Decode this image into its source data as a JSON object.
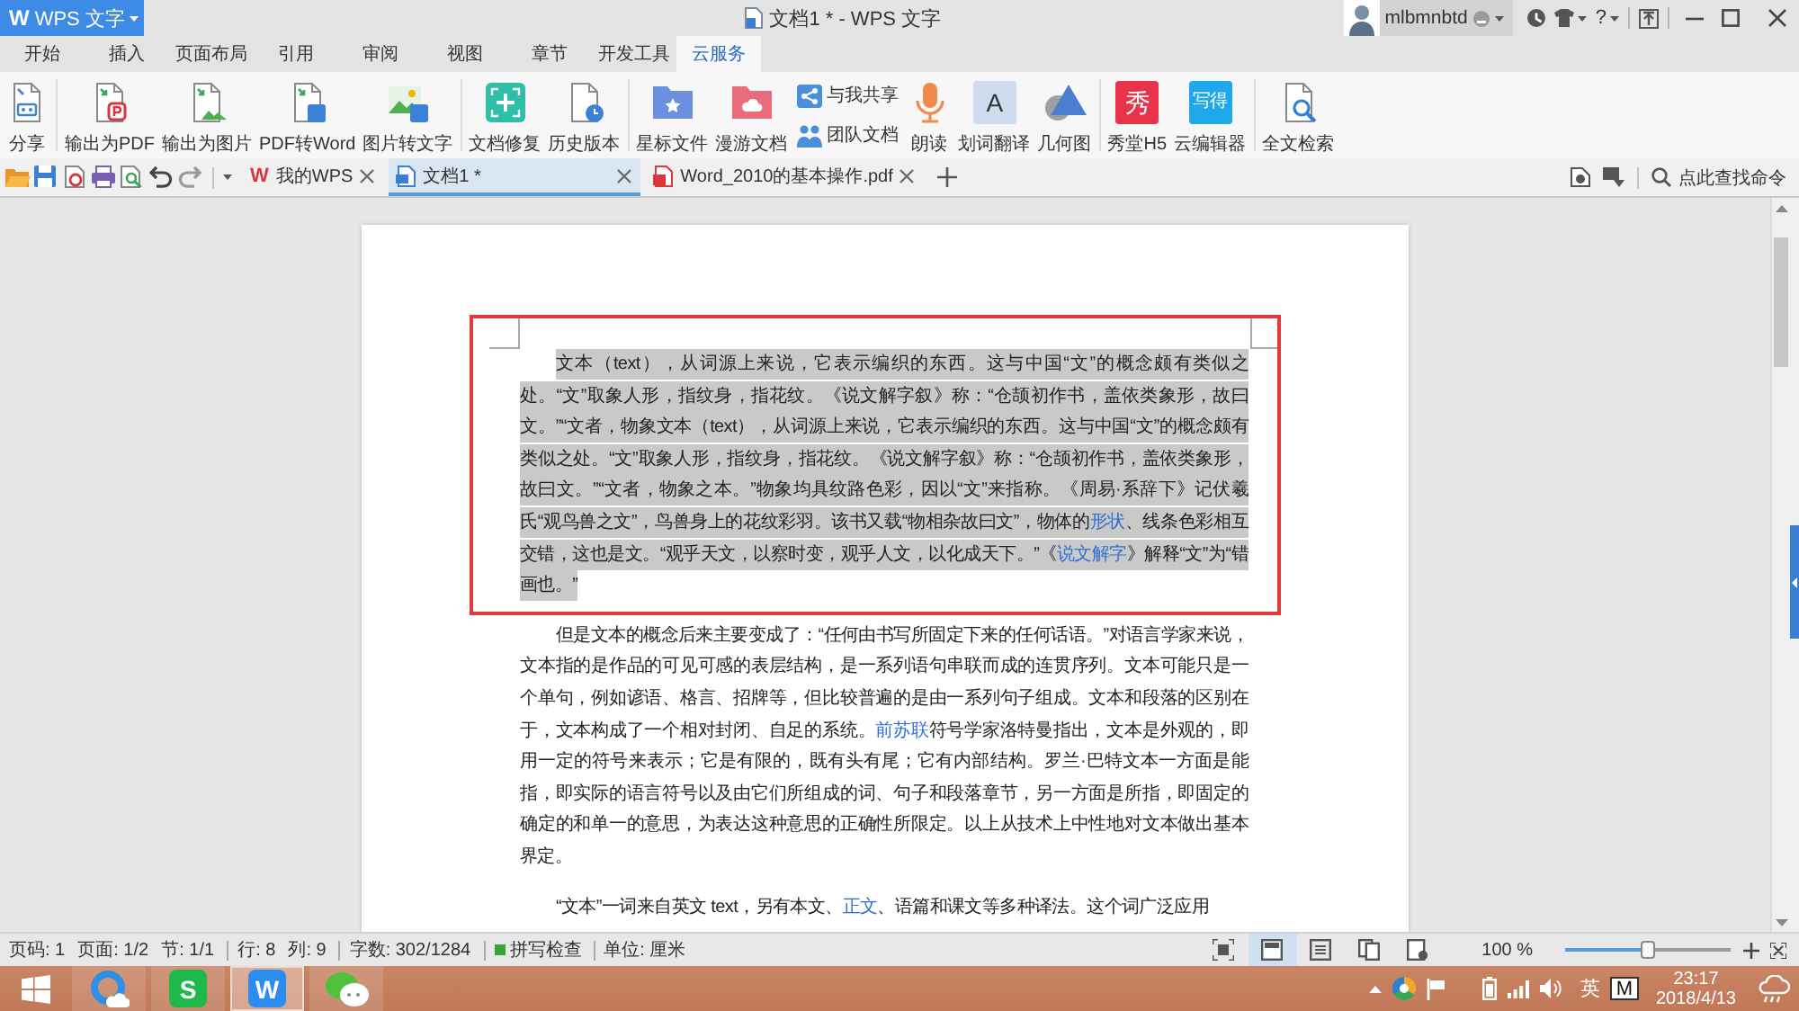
{
  "title_bar": {
    "app_menu": {
      "logo": "W",
      "label": "WPS 文字"
    },
    "title": "文档1 * - WPS 文字",
    "user": "mlbmnbtd",
    "help": "?"
  },
  "menu_tabs": [
    {
      "label": "开始",
      "selected": false
    },
    {
      "label": "插入",
      "selected": false
    },
    {
      "label": "页面布局",
      "selected": false
    },
    {
      "label": "引用",
      "selected": false
    },
    {
      "label": "审阅",
      "selected": false
    },
    {
      "label": "视图",
      "selected": false
    },
    {
      "label": "章节",
      "selected": false
    },
    {
      "label": "开发工具",
      "selected": false
    },
    {
      "label": "云服务",
      "selected": true
    }
  ],
  "ribbon": {
    "groups": [
      [
        {
          "kind": "large",
          "label": "分享"
        }
      ],
      [
        {
          "kind": "large",
          "label": "输出为PDF"
        },
        {
          "kind": "large",
          "label": "输出为图片"
        },
        {
          "kind": "large",
          "label": "PDF转Word"
        },
        {
          "kind": "large",
          "label": "图片转文字"
        }
      ],
      [
        {
          "kind": "large",
          "label": "文档修复"
        },
        {
          "kind": "large",
          "label": "历史版本"
        }
      ],
      [
        {
          "kind": "large",
          "label": "星标文件"
        },
        {
          "kind": "large",
          "label": "漫游文档"
        },
        {
          "kind": "stack",
          "items": [
            {
              "label": "与我共享"
            },
            {
              "label": "团队文档"
            }
          ]
        },
        {
          "kind": "large",
          "label": "朗读"
        },
        {
          "kind": "large",
          "label": "划词翻译",
          "icon_text": "A"
        },
        {
          "kind": "large",
          "label": "几何图"
        }
      ],
      [
        {
          "kind": "large",
          "label": "秀堂H5",
          "icon_text": "秀"
        },
        {
          "kind": "large",
          "label": "云编辑器",
          "icon_text": "写得"
        }
      ],
      [
        {
          "kind": "large",
          "label": "全文检索"
        }
      ]
    ]
  },
  "quick_bar": {
    "doc_tabs": [
      {
        "kind": "home",
        "logo": "W",
        "label": "我的WPS",
        "selected": false
      },
      {
        "kind": "document",
        "label": "文档1 *",
        "selected": true
      },
      {
        "kind": "pdf",
        "label": "Word_2010的基本操作.pdf",
        "selected": false
      }
    ],
    "command_search": "点此查找命令"
  },
  "document": {
    "paragraphs": [
      {
        "selected": true,
        "framed": true,
        "segments": [
          {
            "kind": "text",
            "text": "文本（text），从词源上来说，它表示编织的东西。这与中国“文”的概念颇有类似之处。“文”取象人形，指纹身，指花纹。《说文解字叙》称：“仓颉初作书，盖依类象形，故曰文。”“文者，物象文本（text），从词源上来说，它表示编织的东西。这与中国“文”的概念颇有类似之处。“文”取象人形，指纹身，指花纹。《说文解字叙》称：“仓颉初作书，盖依类象形，故曰文。”“文者，物象之本。”物象均具纹路色彩，因以“文”来指称。《周易·系辞下》记伏羲氏“观鸟兽之文”，鸟兽身上的花纹彩羽。该书又载“物相杂故曰文”，物体的"
          },
          {
            "kind": "link",
            "text": "形状"
          },
          {
            "kind": "text",
            "text": "、线条色彩相互交错，这也是文。“观乎天文，以察时变，观乎人文，以化成天下。”《"
          },
          {
            "kind": "link",
            "text": "说文解字"
          },
          {
            "kind": "text",
            "text": "》解释“文”为“错画也。”"
          }
        ]
      },
      {
        "selected": false,
        "framed": false,
        "segments": [
          {
            "kind": "text",
            "text": "但是文本的概念后来主要变成了：“任何由书写所固定下来的任何话语。”对语言学家来说，文本指的是作品的可见可感的表层结构，是一系列语句串联而成的连贯序列。文本可能只是一个单句，例如谚语、格言、招牌等，但比较普遍的是由一系列句子组成。文本和段落的区别在于，文本构成了一个相对封闭、自足的系统。"
          },
          {
            "kind": "link",
            "text": "前苏联"
          },
          {
            "kind": "text",
            "text": "符号学家洛特曼指出，文本是外观的，即用一定的符号来表示；它是有限的，既有头有尾；它有内部结构。罗兰·巴特文本一方面是能指，即实际的语言符号以及由它们所组成的词、句子和段落章节，另一方面是所指，即固定的确定的和单一的意思，为表达这种意思的正确性所限定。以上从技术上中性地对文本做出基本界定。"
          }
        ]
      },
      {
        "selected": false,
        "framed": false,
        "segments": [
          {
            "kind": "text",
            "text": "“文本”一词来自英文 text，另有本文、"
          },
          {
            "kind": "link",
            "text": "正文"
          },
          {
            "kind": "text",
            "text": "、语篇和课文等多种译法。这个词广泛应用"
          }
        ]
      }
    ]
  },
  "status_bar": {
    "groups": [
      [
        "页码: 1",
        "页面: 1/2",
        "节: 1/1"
      ],
      [
        "行: 8",
        "列: 9"
      ],
      [
        "字数: 302/1284"
      ]
    ],
    "spell_check": {
      "label": "拼写检查",
      "on": true
    },
    "unit": "单位: 厘米",
    "view_modes": [
      {
        "selected": false
      },
      {
        "selected": true
      },
      {
        "selected": false
      },
      {
        "selected": false
      },
      {
        "selected": false
      }
    ],
    "zoom": {
      "reading": "100 %",
      "level": 0.5
    }
  },
  "taskbar": {
    "apps": [
      {
        "kind": "browser",
        "selected": false
      },
      {
        "kind": "spreadsheet",
        "glyph": "S",
        "selected": false
      },
      {
        "kind": "writer",
        "glyph": "W",
        "selected": true
      },
      {
        "kind": "chat",
        "selected": false
      }
    ],
    "tray": {
      "ime": "英",
      "ime_mode": "M",
      "time": "23:17",
      "date": "2018/4/13"
    }
  }
}
